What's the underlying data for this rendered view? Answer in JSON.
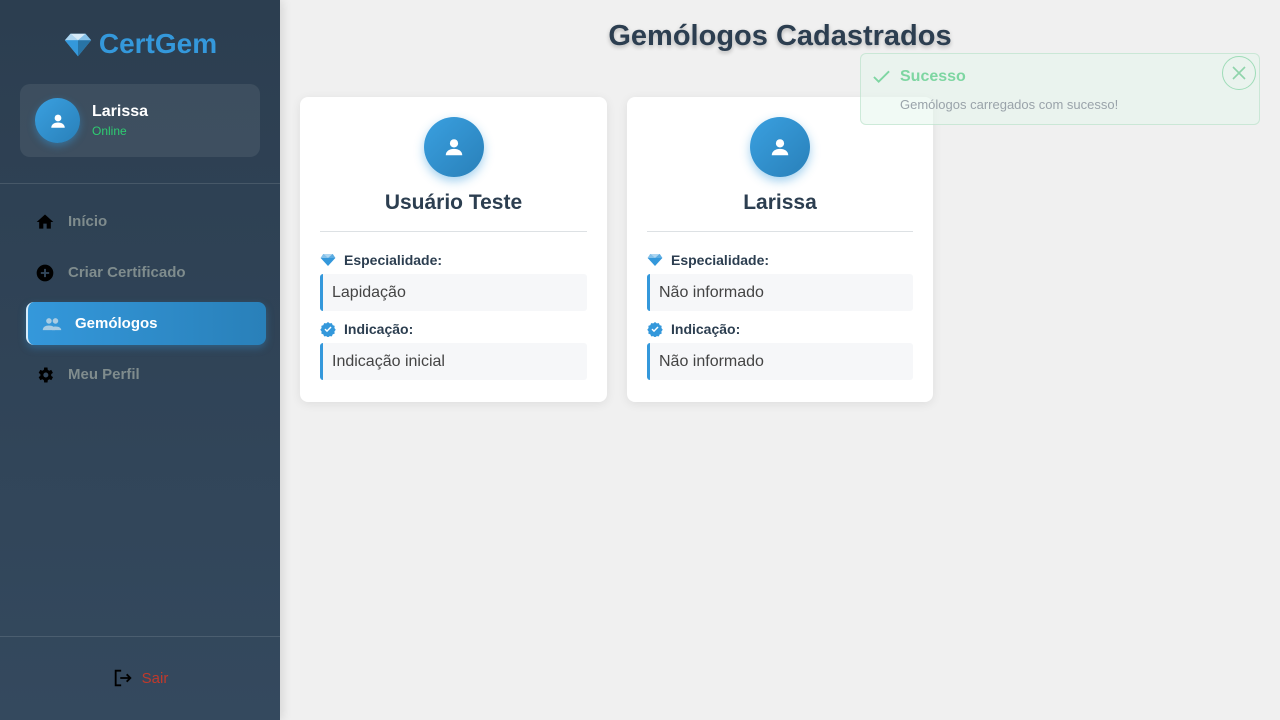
{
  "app": {
    "brand": "CertGem"
  },
  "user": {
    "name": "Larissa",
    "status": "Online"
  },
  "nav": {
    "items": [
      {
        "label": "Início",
        "icon": "home-icon",
        "active": false
      },
      {
        "label": "Criar Certificado",
        "icon": "add-circle-icon",
        "active": false
      },
      {
        "label": "Gemólogos",
        "icon": "people-icon",
        "active": true
      },
      {
        "label": "Meu Perfil",
        "icon": "gear-icon",
        "active": false
      }
    ],
    "logout": "Sair"
  },
  "page": {
    "title": "Gemólogos Cadastrados"
  },
  "cards": [
    {
      "name": "Usuário Teste",
      "specialty_label": "Especialidade:",
      "specialty": "Lapidação",
      "referral_label": "Indicação:",
      "referral": "Indicação inicial"
    },
    {
      "name": "Larissa",
      "specialty_label": "Especialidade:",
      "specialty": "Não informado",
      "referral_label": "Indicação:",
      "referral": "Não informado"
    }
  ],
  "toast": {
    "title": "Sucesso",
    "message": "Gemólogos carregados com sucesso!"
  },
  "colors": {
    "accent": "#3498db",
    "sidebar": "#2c3e50",
    "online": "#2ecc71",
    "logout": "#c0392b",
    "success": "#7ed6a2"
  }
}
